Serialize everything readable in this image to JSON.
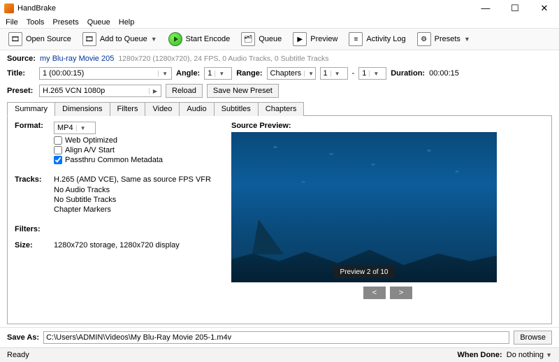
{
  "app": {
    "title": "HandBrake"
  },
  "menu": {
    "file": "File",
    "tools": "Tools",
    "presets": "Presets",
    "queue": "Queue",
    "help": "Help"
  },
  "toolbar": {
    "open_source": "Open Source",
    "add_to_queue": "Add to Queue",
    "start_encode": "Start Encode",
    "queue": "Queue",
    "preview": "Preview",
    "activity_log": "Activity Log",
    "presets": "Presets"
  },
  "source": {
    "label": "Source:",
    "name": "my Blu-ray Movie 205",
    "info": "1280x720 (1280x720), 24 FPS, 0 Audio Tracks, 0 Subtitle Tracks"
  },
  "title": {
    "label": "Title:",
    "value": "1  (00:00:15)"
  },
  "angle": {
    "label": "Angle:",
    "value": "1"
  },
  "range": {
    "label": "Range:",
    "type": "Chapters",
    "from": "1",
    "dash": "-",
    "to": "1"
  },
  "duration": {
    "label": "Duration:",
    "value": "00:00:15"
  },
  "preset": {
    "label": "Preset:",
    "value": "H.265 VCN 1080p",
    "reload": "Reload",
    "save_new": "Save New Preset"
  },
  "tabs": {
    "summary": "Summary",
    "dimensions": "Dimensions",
    "filters": "Filters",
    "video": "Video",
    "audio": "Audio",
    "subtitles": "Subtitles",
    "chapters": "Chapters"
  },
  "summary": {
    "format_label": "Format:",
    "format_value": "MP4",
    "web_optimized": "Web Optimized",
    "align_av": "Align A/V Start",
    "passthru": "Passthru Common Metadata",
    "tracks_label": "Tracks:",
    "track1": "H.265 (AMD VCE), Same as source FPS VFR",
    "track2": "No Audio Tracks",
    "track3": "No Subtitle Tracks",
    "track4": "Chapter Markers",
    "filters_label": "Filters:",
    "size_label": "Size:",
    "size_value": "1280x720 storage, 1280x720 display",
    "preview_label": "Source Preview:",
    "preview_overlay": "Preview 2 of 10",
    "prev": "<",
    "next": ">"
  },
  "save": {
    "label": "Save As:",
    "path": "C:\\Users\\ADMIN\\Videos\\My Blu-Ray Movie 205-1.m4v",
    "browse": "Browse"
  },
  "status": {
    "ready": "Ready",
    "when_done_label": "When Done:",
    "when_done_value": "Do nothing"
  }
}
